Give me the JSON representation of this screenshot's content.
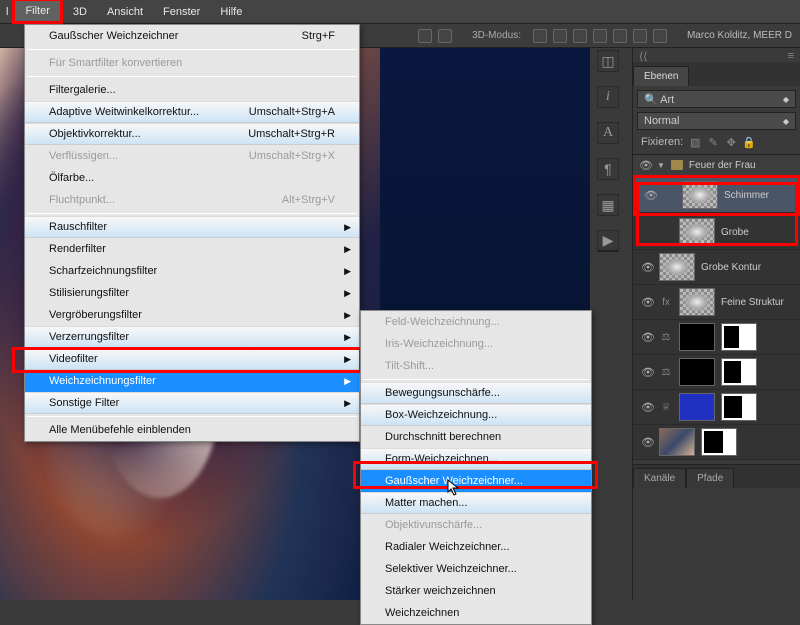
{
  "menubar": {
    "filter": "Filter",
    "threed": "3D",
    "view": "Ansicht",
    "window": "Fenster",
    "help": "Hilfe"
  },
  "toolbar": {
    "mode": "3D-Modus:",
    "user": "Marco Kolditz, MEER D"
  },
  "menu": {
    "gauss": "Gaußscher Weichzeichner",
    "gauss_sc": "Strg+F",
    "smart": "Für Smartfilter konvertieren",
    "gallery": "Filtergalerie...",
    "adaptive": "Adaptive Weitwinkelkorrektur...",
    "adaptive_sc": "Umschalt+Strg+A",
    "lens": "Objektivkorrektur...",
    "lens_sc": "Umschalt+Strg+R",
    "liquify": "Verflüssigen...",
    "liquify_sc": "Umschalt+Strg+X",
    "oil": "Ölfarbe...",
    "vanish": "Fluchtpunkt...",
    "vanish_sc": "Alt+Strg+V",
    "noise": "Rauschfilter",
    "render": "Renderfilter",
    "sharpen": "Scharfzeichnungsfilter",
    "stylize": "Stilisierungsfilter",
    "pixelate": "Vergröberungsfilter",
    "distort": "Verzerrungsfilter",
    "video": "Videofilter",
    "blur": "Weichzeichnungsfilter",
    "other": "Sonstige Filter",
    "allmenu": "Alle Menübefehle einblenden"
  },
  "submenu": {
    "field": "Feld-Weichzeichnung...",
    "iris": "Iris-Weichzeichnung...",
    "tilt": "Tilt-Shift...",
    "motion": "Bewegungsunschärfe...",
    "box": "Box-Weichzeichnung...",
    "avg": "Durchschnitt berechnen",
    "shape": "Form-Weichzeichnen...",
    "gaussfull": "Gaußscher Weichzeichner...",
    "matte": "Matter machen...",
    "lensblur": "Objektivunschärfe...",
    "radial": "Radialer Weichzeichner...",
    "smart": "Selektiver Weichzeichner...",
    "more": "Stärker weichzeichnen",
    "normal": "Weichzeichnen"
  },
  "panels": {
    "layers_tab": "Ebenen",
    "kind": "Art",
    "blend": "Normal",
    "fix": "Fixieren:",
    "group": "Feuer der Frau",
    "l1": "Schimmer",
    "l2": "Grobe",
    "l3": "Grobe Kontur",
    "l4": "Feine Struktur",
    "ch": "Kanäle",
    "pf": "Pfade"
  }
}
